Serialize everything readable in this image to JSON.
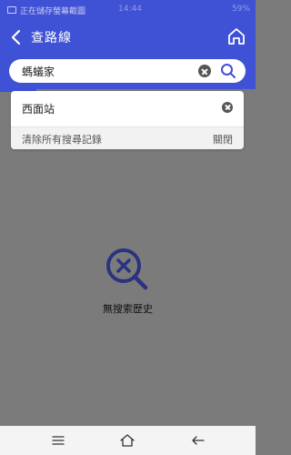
{
  "status_bar": {
    "notification_text": "正在儲存螢幕截圖",
    "time": "14:44",
    "right_info": "59%"
  },
  "header": {
    "title": "查路線"
  },
  "search": {
    "value": "螞蟻家"
  },
  "history": {
    "items": [
      {
        "label": "西面站"
      }
    ],
    "clear_all_label": "清除所有搜尋記錄",
    "close_label": "關閉"
  },
  "empty_state": {
    "message": "無搜索歷史"
  },
  "colors": {
    "primary": "#3f51d4",
    "overlay": "#7b7b7b",
    "icon_dark": "#2b3380"
  }
}
